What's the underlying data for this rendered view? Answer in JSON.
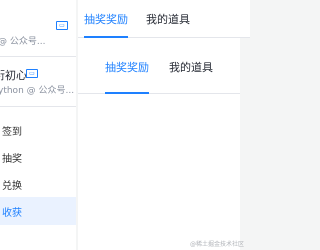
{
  "sidebar": {
    "profile_top": {
      "badge": "▭",
      "subtitle": "@ 公众号..."
    },
    "profile_2": {
      "name": "衍初心",
      "badge": "▭",
      "subtitle": "ython @ 公众号..."
    },
    "menu": [
      {
        "label": "签到",
        "active": false
      },
      {
        "label": "抽奖",
        "active": false
      },
      {
        "label": "兑换",
        "active": false
      },
      {
        "label": "收获",
        "active": true
      }
    ]
  },
  "outer_tabs": [
    {
      "label": "抽奖奖励",
      "active": true
    },
    {
      "label": "我的道具",
      "active": false
    }
  ],
  "inner_tabs": [
    {
      "label": "抽奖奖励",
      "active": true
    },
    {
      "label": "我的道具",
      "active": false
    }
  ],
  "watermark": "@稀土掘金技术社区",
  "colors": {
    "accent": "#1e80ff",
    "active_bg": "#eaf2ff",
    "page_bg": "#f4f5f5"
  }
}
